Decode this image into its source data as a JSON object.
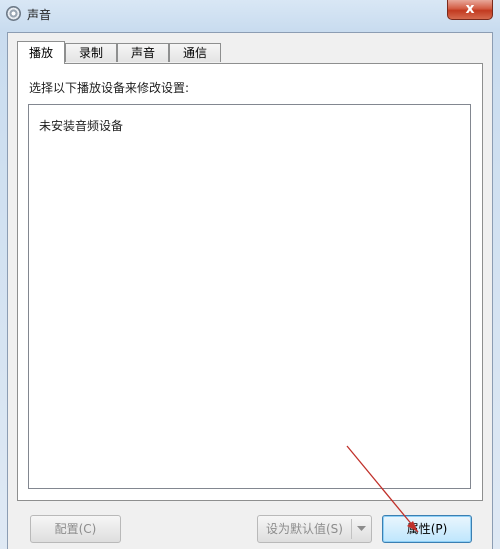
{
  "window": {
    "title": "声音",
    "close_glyph": "x"
  },
  "tabs": [
    {
      "label": "播放",
      "active": true
    },
    {
      "label": "录制",
      "active": false
    },
    {
      "label": "声音",
      "active": false
    },
    {
      "label": "通信",
      "active": false
    }
  ],
  "panel": {
    "instruction": "选择以下播放设备来修改设置:",
    "empty_message": "未安装音频设备"
  },
  "buttons": {
    "configure": "配置(C)",
    "set_default": "设为默认值(S)",
    "properties": "属性(P)"
  },
  "icons": {
    "app": "speaker-icon",
    "close": "close-icon",
    "dropdown": "chevron-down-icon"
  },
  "colors": {
    "close_button": "#c8432a",
    "annotation_arrow": "#c0302a",
    "primary_button_border": "#3c7fb1"
  }
}
